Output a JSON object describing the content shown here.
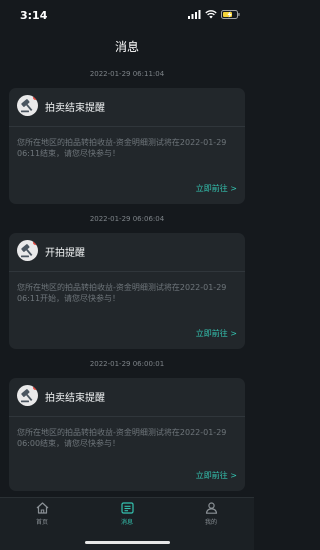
{
  "status_bar": {
    "time": "3:14"
  },
  "header": {
    "title": "消息"
  },
  "messages": [
    {
      "time": "2022-01-29 06:11:04",
      "title": "拍卖结束提醒",
      "body": "您所在地区的拍品转拍收益-资金明细测试将在2022-01-29 06:11结束，请您尽快参与！",
      "link": "立即前往 >"
    },
    {
      "time": "2022-01-29 06:06:04",
      "title": "开拍提醒",
      "body": "您所在地区的拍品转拍收益-资金明细测试将在2022-01-29 06:11开始，请您尽快参与！",
      "link": "立即前往 >"
    },
    {
      "time": "2022-01-29 06:00:01",
      "title": "拍卖结束提醒",
      "body": "您所在地区的拍品转拍收益-资金明细测试将在2022-01-29 06:00结束，请您尽快参与！",
      "link": "立即前往 >"
    }
  ],
  "tabbar": {
    "items": [
      {
        "label": "首页",
        "icon": "home-icon"
      },
      {
        "label": "消息",
        "icon": "message-icon",
        "active": true
      },
      {
        "label": "我的",
        "icon": "profile-icon"
      }
    ]
  },
  "colors": {
    "accent": "#34c3b0",
    "background": "#15191d",
    "card": "#22272b",
    "badge": "#e0443c"
  }
}
